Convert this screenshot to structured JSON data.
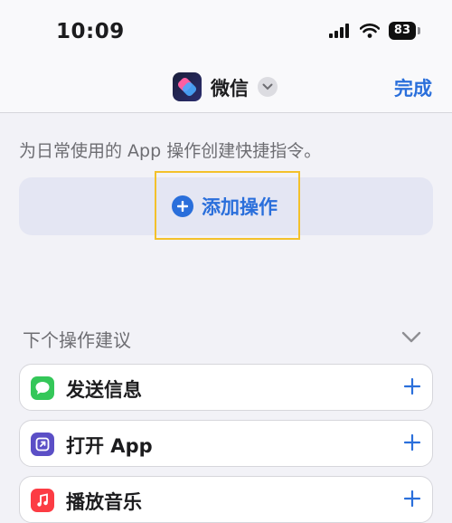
{
  "status_bar": {
    "time": "10:09",
    "battery": "83"
  },
  "nav": {
    "title": "微信",
    "done_label": "完成"
  },
  "hint": "为日常使用的 App 操作创建快捷指令。",
  "add_action": {
    "label": "添加操作"
  },
  "suggestions": {
    "title": "下个操作建议",
    "items": [
      {
        "label": "发送信息",
        "icon": "messages-icon",
        "color": "#34c759"
      },
      {
        "label": "打开 App",
        "icon": "open-app-icon",
        "color": "#5b4fc6"
      },
      {
        "label": "播放音乐",
        "icon": "music-icon",
        "color": "#fc3c44"
      }
    ]
  },
  "colors": {
    "accent": "#2a6fdb",
    "highlight": "#f3c12b"
  }
}
